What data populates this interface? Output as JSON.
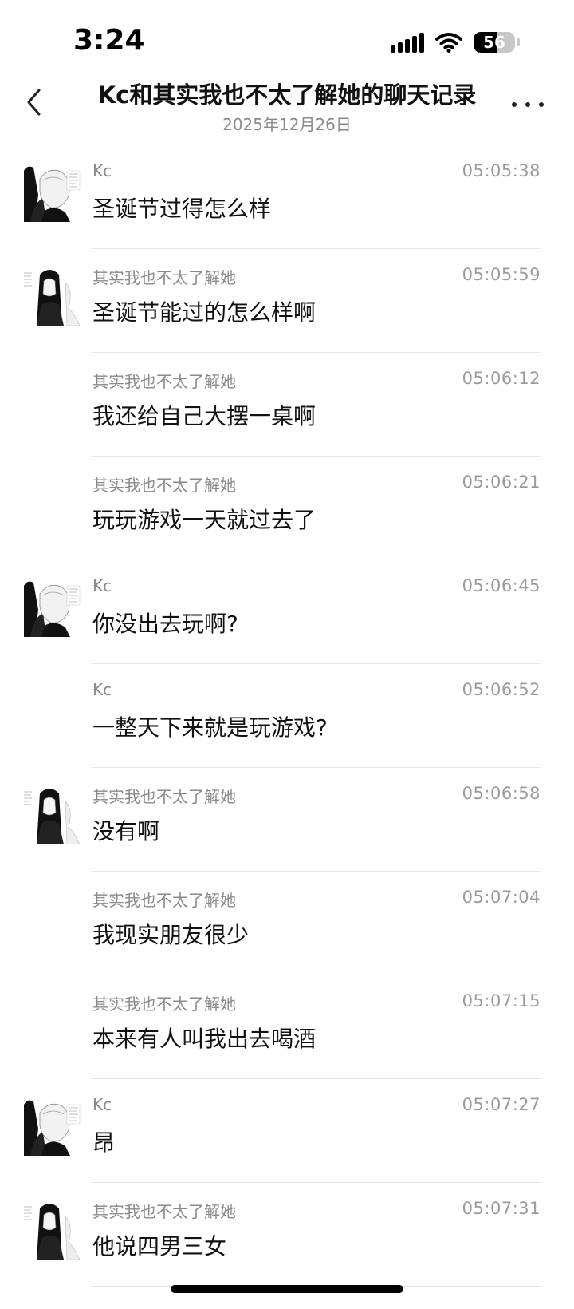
{
  "status_bar": {
    "time": "3:24",
    "battery": "56",
    "battery_level": 0.56
  },
  "header": {
    "title": "Kc和其实我也不太了解她的聊天记录",
    "date": "2025年12月26日"
  },
  "messages": [
    {
      "sender": "Kc",
      "time": "05:05:38",
      "text": "圣诞节过得怎么样",
      "avatar": "kc"
    },
    {
      "sender": "其实我也不太了解她",
      "time": "05:05:59",
      "text": "圣诞节能过的怎么样啊",
      "avatar": "her"
    },
    {
      "sender": "其实我也不太了解她",
      "time": "05:06:12",
      "text": "我还给自己大摆一桌啊",
      "avatar": ""
    },
    {
      "sender": "其实我也不太了解她",
      "time": "05:06:21",
      "text": "玩玩游戏一天就过去了",
      "avatar": ""
    },
    {
      "sender": "Kc",
      "time": "05:06:45",
      "text": "你没出去玩啊?",
      "avatar": "kc"
    },
    {
      "sender": "Kc",
      "time": "05:06:52",
      "text": "一整天下来就是玩游戏?",
      "avatar": ""
    },
    {
      "sender": "其实我也不太了解她",
      "time": "05:06:58",
      "text": "没有啊",
      "avatar": "her"
    },
    {
      "sender": "其实我也不太了解她",
      "time": "05:07:04",
      "text": "我现实朋友很少",
      "avatar": ""
    },
    {
      "sender": "其实我也不太了解她",
      "time": "05:07:15",
      "text": "本来有人叫我出去喝酒",
      "avatar": ""
    },
    {
      "sender": "Kc",
      "time": "05:07:27",
      "text": "昂",
      "avatar": "kc"
    },
    {
      "sender": "其实我也不太了解她",
      "time": "05:07:31",
      "text": "他说四男三女",
      "avatar": "her"
    }
  ]
}
